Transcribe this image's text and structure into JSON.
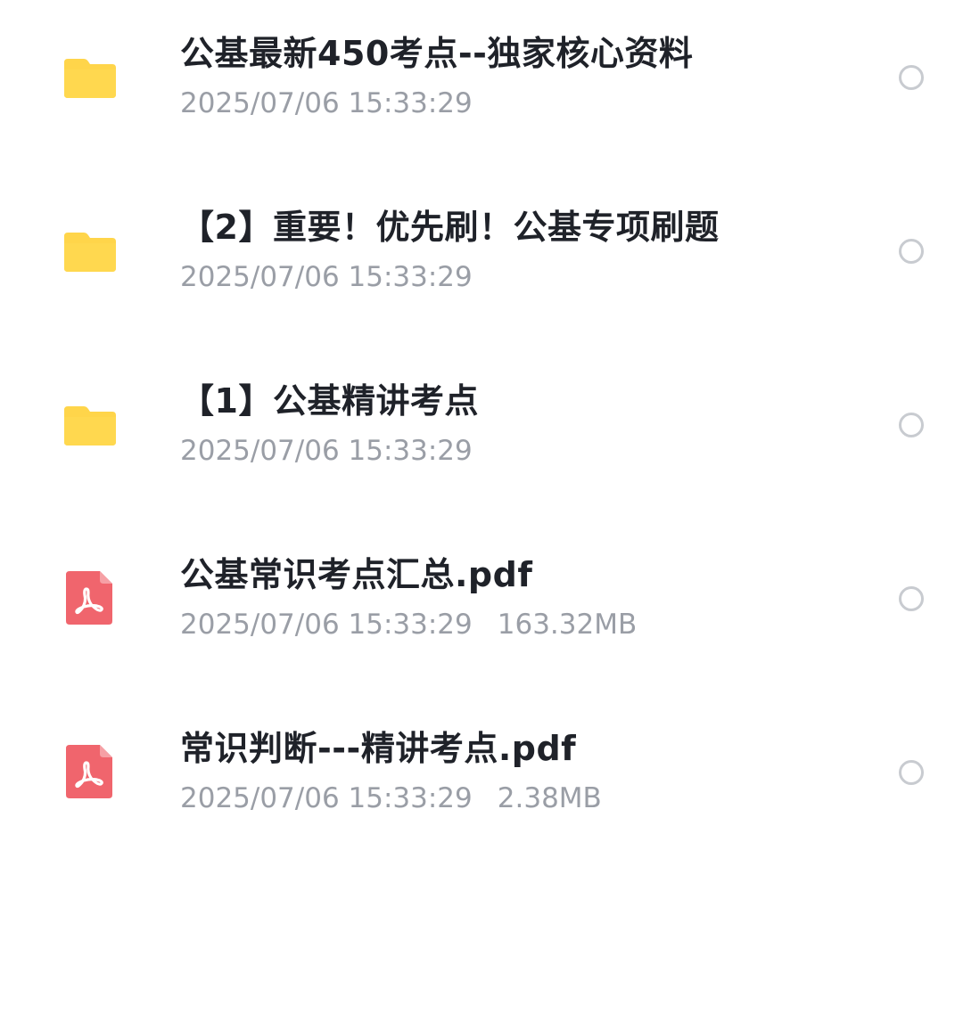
{
  "files": [
    {
      "type": "folder",
      "icon": "folder-icon",
      "name": "公基最新450考点--独家核心资料",
      "modified": "2025/07/06 15:33:29",
      "size": ""
    },
    {
      "type": "folder",
      "icon": "folder-icon",
      "name": "【2】重要！优先刷！公基专项刷题",
      "modified": "2025/07/06 15:33:29",
      "size": ""
    },
    {
      "type": "folder",
      "icon": "folder-icon",
      "name": "【1】公基精讲考点",
      "modified": "2025/07/06 15:33:29",
      "size": ""
    },
    {
      "type": "pdf",
      "icon": "pdf-icon",
      "name": "公基常识考点汇总.pdf",
      "modified": "2025/07/06 15:33:29",
      "size": "163.32MB"
    },
    {
      "type": "pdf",
      "icon": "pdf-icon",
      "name": "常识判断---精讲考点.pdf",
      "modified": "2025/07/06 15:33:29",
      "size": "2.38MB"
    }
  ],
  "colors": {
    "folder": "#ffd54a",
    "pdf": "#f0656d",
    "title_text": "#1f2229",
    "meta_text": "#9a9ea6",
    "radio_border": "#c8cbd0"
  }
}
